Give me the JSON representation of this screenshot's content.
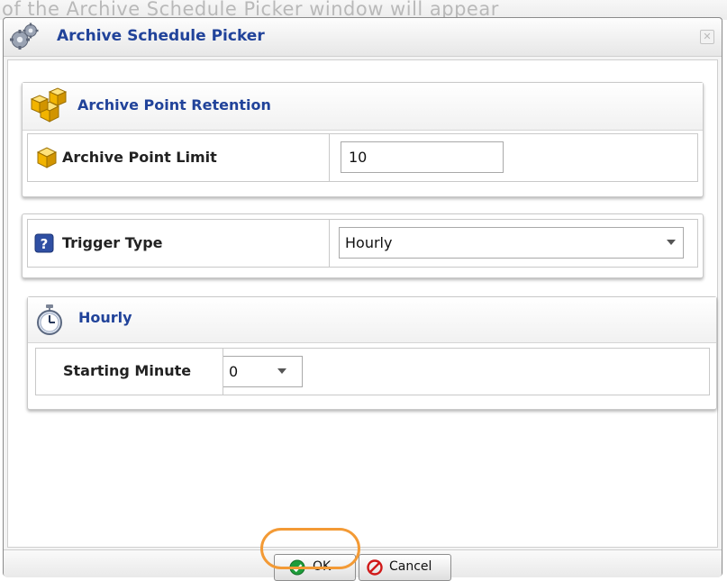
{
  "background": {
    "partial_text": "of the Archive Schedule Picker window will appear"
  },
  "dialog": {
    "title": "Archive Schedule Picker",
    "title_icon": "gears-icon",
    "close_icon": "close-icon",
    "accent_color": "#21439a"
  },
  "retention_panel": {
    "title": "Archive Point Retention",
    "icon": "stacked-cubes-icon",
    "limit_row": {
      "label": "Archive Point Limit",
      "icon": "cube-icon",
      "value": "10"
    }
  },
  "trigger_panel": {
    "label": "Trigger Type",
    "icon": "help-icon",
    "selected": "Hourly"
  },
  "hourly_panel": {
    "title": "Hourly",
    "icon": "stopwatch-icon",
    "starting_minute": {
      "label": "Starting Minute",
      "selected": "0"
    }
  },
  "footer": {
    "ok_label": "OK",
    "cancel_label": "Cancel",
    "ok_icon": "check-circle-icon",
    "cancel_icon": "no-entry-icon",
    "highlight_color": "#f39a35"
  }
}
